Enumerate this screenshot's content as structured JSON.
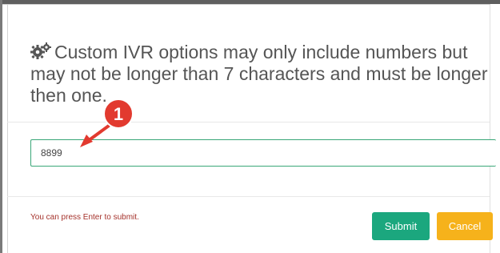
{
  "dialog": {
    "prompt_icon": "gears-icon",
    "prompt": "Custom IVR options may only include numbers but may not be longer than 7 characters and must be longer then one.",
    "input_value": "8899",
    "hint": "You can press Enter to submit.",
    "submit_label": "Submit",
    "cancel_label": "Cancel"
  },
  "annotation": {
    "step_number": "1",
    "badge_color": "#e23a2f",
    "arrow_color": "#e23a2f"
  },
  "colors": {
    "input_border": "#3aa778",
    "submit_bg": "#1ba77e",
    "cancel_bg": "#f6b21b",
    "hint_text": "#a5322b"
  }
}
